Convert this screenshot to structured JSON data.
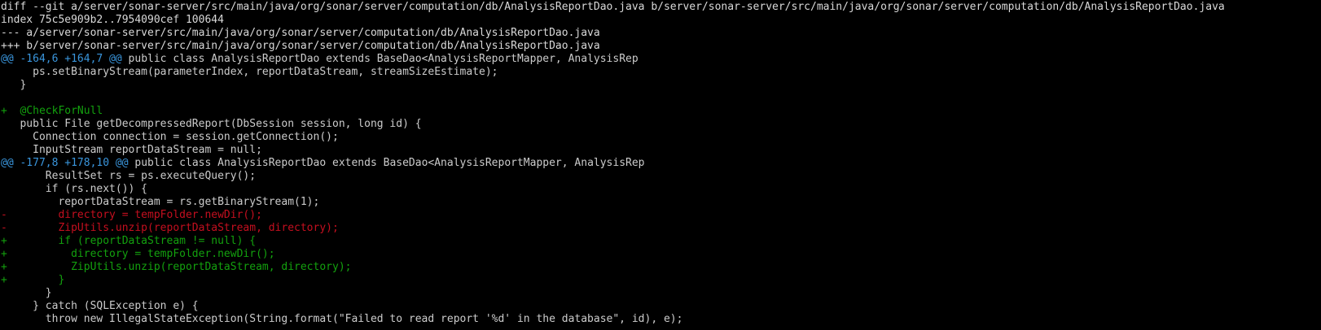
{
  "terminal": {
    "lines": [
      {
        "type": "header",
        "text": "diff --git a/server/sonar-server/src/main/java/org/sonar/server/computation/db/AnalysisReportDao.java b/server/sonar-server/src/main/java/org/sonar/server/computation/db/AnalysisReportDao.java"
      },
      {
        "type": "header",
        "text": "index 75c5e909b2..7954090cef 100644"
      },
      {
        "type": "header",
        "text": "--- a/server/sonar-server/src/main/java/org/sonar/server/computation/db/AnalysisReportDao.java"
      },
      {
        "type": "header",
        "text": "+++ b/server/sonar-server/src/main/java/org/sonar/server/computation/db/AnalysisReportDao.java"
      },
      {
        "type": "hunk",
        "range": "@@ -164,6 +164,7 @@",
        "text": " public class AnalysisReportDao extends BaseDao<AnalysisReportMapper, AnalysisRep"
      },
      {
        "type": "context",
        "text": "     ps.setBinaryStream(parameterIndex, reportDataStream, streamSizeEstimate);"
      },
      {
        "type": "context",
        "text": "   }"
      },
      {
        "type": "context",
        "text": " "
      },
      {
        "type": "added",
        "text": "+  @CheckForNull"
      },
      {
        "type": "context",
        "text": "   public File getDecompressedReport(DbSession session, long id) {"
      },
      {
        "type": "context",
        "text": "     Connection connection = session.getConnection();"
      },
      {
        "type": "context",
        "text": "     InputStream reportDataStream = null;"
      },
      {
        "type": "hunk",
        "range": "@@ -177,8 +178,10 @@",
        "text": " public class AnalysisReportDao extends BaseDao<AnalysisReportMapper, AnalysisRep"
      },
      {
        "type": "context",
        "text": "       ResultSet rs = ps.executeQuery();"
      },
      {
        "type": "context",
        "text": "       if (rs.next()) {"
      },
      {
        "type": "context",
        "text": "         reportDataStream = rs.getBinaryStream(1);"
      },
      {
        "type": "removed",
        "text": "-        directory = tempFolder.newDir();"
      },
      {
        "type": "removed",
        "text": "-        ZipUtils.unzip(reportDataStream, directory);"
      },
      {
        "type": "added",
        "text": "+        if (reportDataStream != null) {"
      },
      {
        "type": "added",
        "text": "+          directory = tempFolder.newDir();"
      },
      {
        "type": "added",
        "text": "+          ZipUtils.unzip(reportDataStream, directory);"
      },
      {
        "type": "added",
        "text": "+        }"
      },
      {
        "type": "context",
        "text": "       }"
      },
      {
        "type": "context",
        "text": "     } catch (SQLException e) {"
      },
      {
        "type": "context",
        "text": "       throw new IllegalStateException(String.format(\"Failed to read report '%d' in the database\", id), e);"
      }
    ]
  },
  "colors": {
    "background": "#000000",
    "text": "#cccccc",
    "added": "#13a10e",
    "removed": "#c50f1f",
    "hunk_range": "#3a96dd"
  }
}
